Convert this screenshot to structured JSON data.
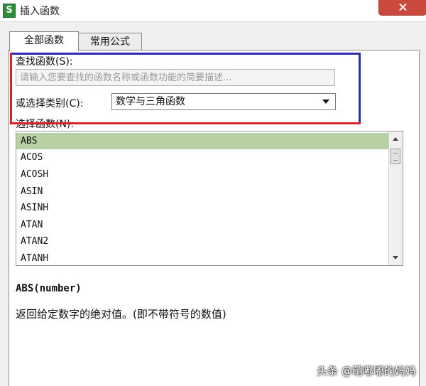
{
  "window": {
    "app_icon": "S",
    "title": "插入函数"
  },
  "tabs": [
    {
      "label": "全部函数",
      "active": true
    },
    {
      "label": "常用公式",
      "active": false
    }
  ],
  "search": {
    "label": "查找函数(S):",
    "placeholder": "请输入您要查找的函数名称或函数功能的简要描述..."
  },
  "category": {
    "label": "或选择类别(C):",
    "selected": "数学与三角函数"
  },
  "function_list": {
    "label": "选择函数(N):",
    "items": [
      "ABS",
      "ACOS",
      "ACOSH",
      "ASIN",
      "ASINH",
      "ATAN",
      "ATAN2",
      "ATANH"
    ],
    "selected_index": 0
  },
  "details": {
    "signature": "ABS(number)",
    "description": "返回给定数字的绝对值。(即不带符号的数值)"
  },
  "watermark": "头条 @萌嘟嘟的妈妈",
  "colors": {
    "highlight_outline_blue": "#2d2dad",
    "highlight_outline_red": "#d8232a",
    "selected_row": "#b7d1a5",
    "close_button": "#c94a3c"
  }
}
